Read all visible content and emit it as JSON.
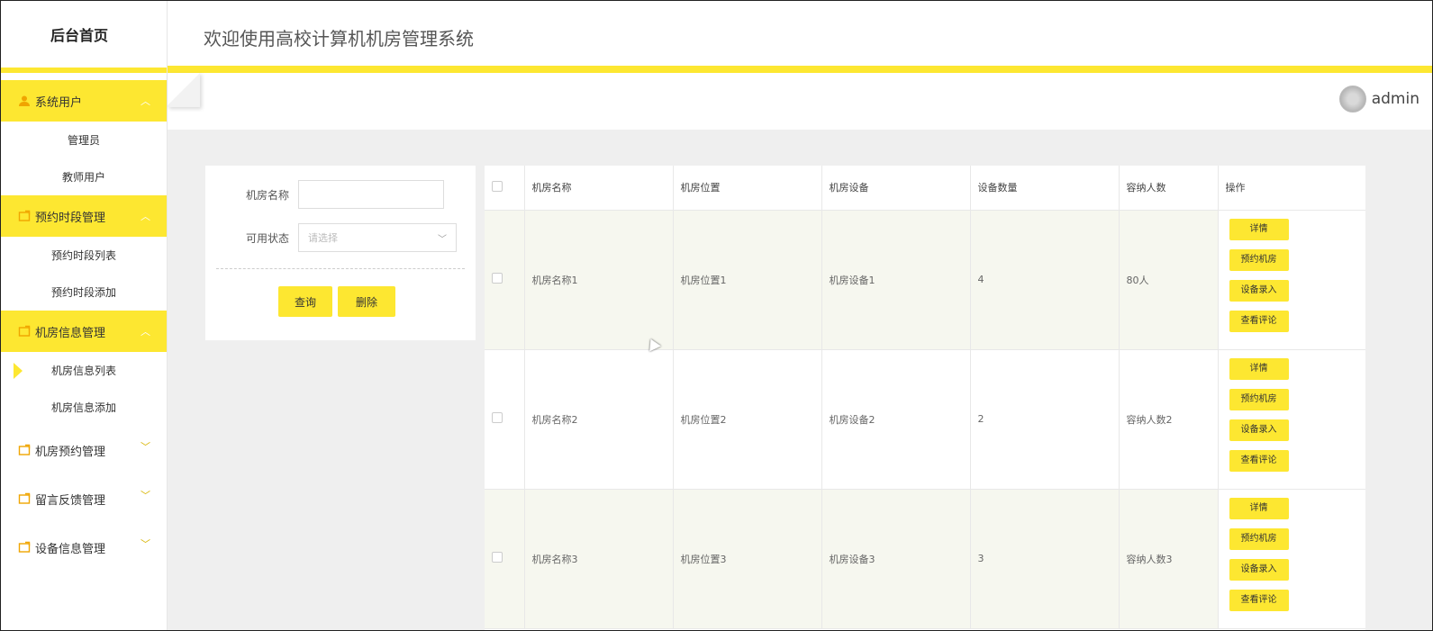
{
  "app": {
    "brand": "后台首页",
    "title": "欢迎使用高校计算机机房管理系统"
  },
  "user": {
    "name": "admin"
  },
  "sidebar": {
    "groups": [
      {
        "label": "系统用户",
        "open": true,
        "icon": "user-icon",
        "items": [
          {
            "label": "管理员"
          },
          {
            "label": "教师用户"
          }
        ]
      },
      {
        "label": "预约时段管理",
        "open": true,
        "icon": "folder-icon",
        "items": [
          {
            "label": "预约时段列表"
          },
          {
            "label": "预约时段添加"
          }
        ]
      },
      {
        "label": "机房信息管理",
        "open": true,
        "icon": "folder-icon",
        "items": [
          {
            "label": "机房信息列表",
            "active": true
          },
          {
            "label": "机房信息添加"
          }
        ]
      },
      {
        "label": "机房预约管理",
        "open": false,
        "icon": "folder-icon"
      },
      {
        "label": "留言反馈管理",
        "open": false,
        "icon": "folder-icon"
      },
      {
        "label": "设备信息管理",
        "open": false,
        "icon": "folder-icon"
      }
    ]
  },
  "filter": {
    "name_label": "机房名称",
    "name_value": "",
    "status_label": "可用状态",
    "status_placeholder": "请选择",
    "query_button": "查询",
    "delete_button": "删除"
  },
  "table": {
    "headers": [
      "机房名称",
      "机房位置",
      "机房设备",
      "设备数量",
      "容纳人数",
      "操作"
    ],
    "rows": [
      {
        "name": "机房名称1",
        "location": "机房位置1",
        "equipment": "机房设备1",
        "count": "4",
        "capacity": "80人"
      },
      {
        "name": "机房名称2",
        "location": "机房位置2",
        "equipment": "机房设备2",
        "count": "2",
        "capacity": "容纳人数2"
      },
      {
        "name": "机房名称3",
        "location": "机房位置3",
        "equipment": "机房设备3",
        "count": "3",
        "capacity": "容纳人数3"
      }
    ],
    "ops": [
      "详情",
      "预约机房",
      "设备录入",
      "查看评论"
    ]
  },
  "colors": {
    "accent": "#fde731",
    "background": "#efefef"
  }
}
